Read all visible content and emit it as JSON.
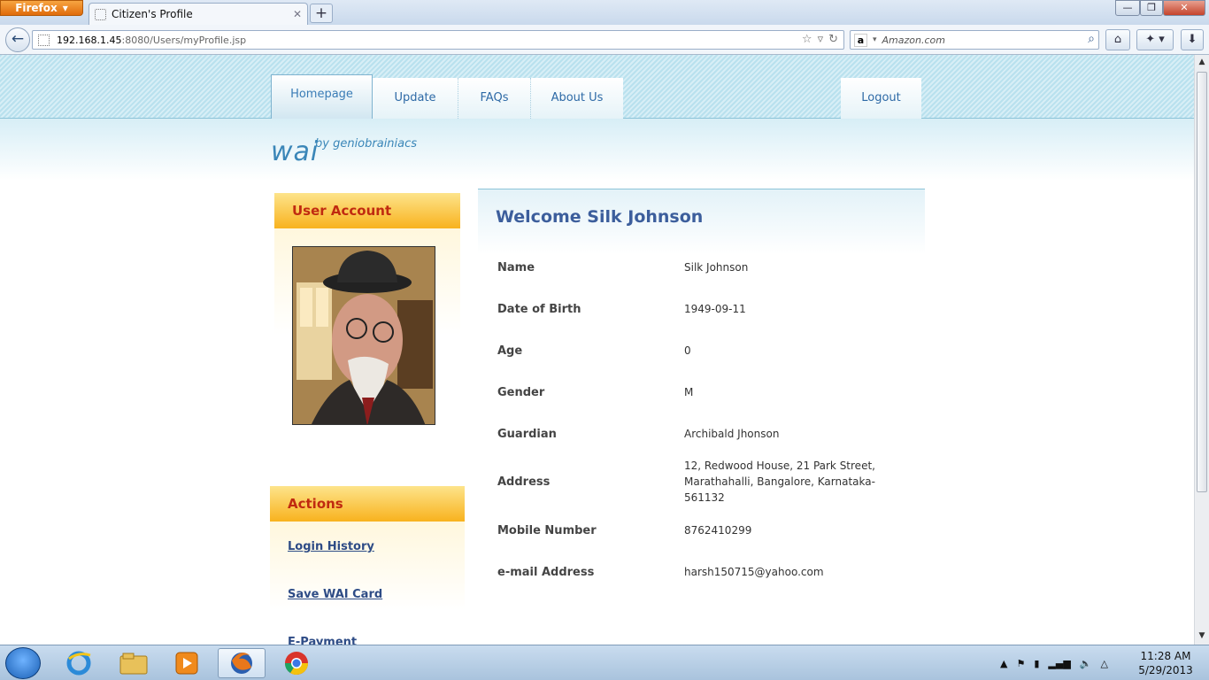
{
  "browser": {
    "menu_label": "Firefox",
    "tab_title": "Citizen's Profile",
    "new_tab": "+",
    "url_host": "192.168.1.45",
    "url_rest": ":8080/Users/myProfile.jsp",
    "search_placeholder": "Amazon.com",
    "search_engine_icon": "a",
    "win_min": "—",
    "win_max": "❐",
    "win_close": "✕"
  },
  "nav": {
    "homepage": "Homepage",
    "update": "Update",
    "faqs": "FAQs",
    "about": "About Us",
    "logout": "Logout"
  },
  "logo": {
    "name": "wai",
    "tagline": "by geniobrainiacs"
  },
  "sidebar": {
    "account_title": "User Account",
    "actions_title": "Actions",
    "actions": [
      "Login History",
      "Save WAI Card",
      "E-Payment"
    ]
  },
  "profile": {
    "welcome": "Welcome Silk Johnson",
    "fields": [
      {
        "label": "Name",
        "value": "Silk Johnson"
      },
      {
        "label": "Date of Birth",
        "value": "1949-09-11"
      },
      {
        "label": "Age",
        "value": "0"
      },
      {
        "label": "Gender",
        "value": "M"
      },
      {
        "label": "Guardian",
        "value": "Archibald Jhonson"
      },
      {
        "label": "Address",
        "value": "12, Redwood House, 21 Park Street, Marathahalli, Bangalore, Karnataka-561132"
      },
      {
        "label": "Mobile Number",
        "value": "8762410299"
      },
      {
        "label": "e-mail Address",
        "value": "harsh150715@yahoo.com"
      }
    ]
  },
  "taskbar": {
    "time": "11:28 AM",
    "date": "5/29/2013"
  },
  "colors": {
    "accent_blue": "#3a86b8",
    "heading_red": "#c02a10",
    "sidebar_gold": "#f8b21e"
  }
}
